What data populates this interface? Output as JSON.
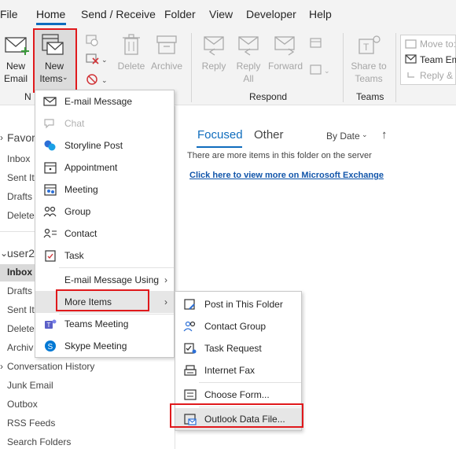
{
  "ribbon_tabs": [
    "File",
    "Home",
    "Send / Receive",
    "Folder",
    "View",
    "Developer",
    "Help"
  ],
  "new_group": {
    "new_email": [
      "New",
      "Email"
    ],
    "new_items": [
      "New",
      "Items"
    ],
    "group_label": "N"
  },
  "delete_group": {
    "delete": "Delete",
    "archive": "Archive"
  },
  "respond_group": {
    "reply": "Reply",
    "reply_all": [
      "Reply",
      "All"
    ],
    "forward": "Forward",
    "label": "Respond"
  },
  "teams_group": {
    "share": [
      "Share to",
      "Teams"
    ],
    "label": "Teams"
  },
  "quick_steps": {
    "move_to": "Move to:",
    "team_email": "Team Em",
    "reply_del": "Reply &"
  },
  "nav": {
    "favorites": "Favor",
    "fav_items": [
      "Inbox",
      "Sent It",
      "Drafts",
      "Delete"
    ],
    "account": "user2",
    "account_items": [
      "Inbox",
      "Drafts",
      "Sent It",
      "Delete",
      "Archiv"
    ],
    "folders": [
      "Conversation History",
      "Junk Email",
      "Outbox",
      "RSS Feeds",
      "Search Folders"
    ]
  },
  "main": {
    "focused": "Focused",
    "other": "Other",
    "sort": "By Date",
    "notice": "There are more items in this folder on the server",
    "link": "Click here to view more on Microsoft Exchange"
  },
  "new_items_menu": [
    {
      "label": "E-mail Message",
      "icon": "envelope-icon"
    },
    {
      "label": "Chat",
      "icon": "chat-icon",
      "disabled": true
    },
    {
      "label": "Storyline Post",
      "icon": "storyline-icon"
    },
    {
      "label": "Appointment",
      "icon": "calendar-icon"
    },
    {
      "label": "Meeting",
      "icon": "meeting-icon"
    },
    {
      "label": "Group",
      "icon": "group-icon"
    },
    {
      "label": "Contact",
      "icon": "contact-icon"
    },
    {
      "label": "Task",
      "icon": "task-icon"
    },
    {
      "label": "E-mail Message Using",
      "icon": "",
      "submenu": true
    },
    {
      "label": "More Items",
      "icon": "",
      "submenu": true
    },
    {
      "label": "Teams Meeting",
      "icon": "teams-icon"
    },
    {
      "label": "Skype Meeting",
      "icon": "skype-icon"
    }
  ],
  "more_items_menu": [
    {
      "label": "Post in This Folder",
      "icon": "post-icon"
    },
    {
      "label": "Contact Group",
      "icon": "contact-group-icon"
    },
    {
      "label": "Task Request",
      "icon": "task-request-icon"
    },
    {
      "label": "Internet Fax",
      "icon": "fax-icon"
    },
    {
      "label": "Choose Form...",
      "icon": "form-icon"
    },
    {
      "label": "Outlook Data File...",
      "icon": "data-file-icon"
    }
  ],
  "colors": {
    "accent": "#0f6cbd",
    "highlight_box": "#e0191c"
  }
}
